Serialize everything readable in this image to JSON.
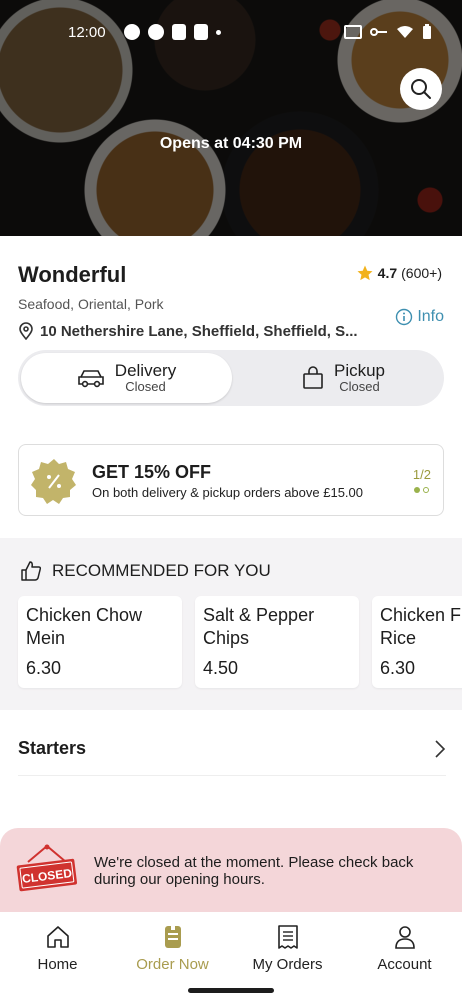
{
  "status_bar": {
    "time": "12:00"
  },
  "hero": {
    "opening_text": "Opens at 04:30 PM",
    "search_icon": "search-icon"
  },
  "restaurant": {
    "name": "Wonderful",
    "rating": "4.7",
    "rating_count": "(600+)",
    "cuisine": "Seafood, Oriental, Pork",
    "address": "10 Nethershire Lane, Sheffield, Sheffield, S...",
    "info_label": "Info"
  },
  "order_mode": {
    "options": [
      {
        "title": "Delivery",
        "status": "Closed",
        "icon": "car-icon",
        "selected": true
      },
      {
        "title": "Pickup",
        "status": "Closed",
        "icon": "bag-icon",
        "selected": false
      }
    ]
  },
  "promo": {
    "title": "GET 15% OFF",
    "subtitle": "On both delivery & pickup orders above £15.00",
    "page": "1/2",
    "badge_icon": "percent-badge-icon"
  },
  "recommended": {
    "heading": "RECOMMENDED FOR YOU",
    "items": [
      {
        "name": "Chicken Chow Mein",
        "price": "6.30"
      },
      {
        "name": "Salt & Pepper Chips",
        "price": "4.50"
      },
      {
        "name": "Chicken Fried Rice",
        "price": "6.30"
      }
    ]
  },
  "menu": {
    "categories": [
      {
        "label": "Starters"
      }
    ]
  },
  "closed_banner": {
    "sign_text": "CLOSED",
    "message": "We're closed at the moment. Please check back during our opening hours."
  },
  "bottom_nav": {
    "items": [
      {
        "label": "Home",
        "icon": "home-icon",
        "active": false
      },
      {
        "label": "Order Now",
        "icon": "menu-icon",
        "active": true
      },
      {
        "label": "My Orders",
        "icon": "receipt-icon",
        "active": false
      },
      {
        "label": "Account",
        "icon": "user-icon",
        "active": false
      }
    ]
  },
  "colors": {
    "accent": "#a99c4f",
    "link": "#3e8fb0",
    "star": "#f2b21b",
    "closed_bg": "#f4d6d9",
    "closed_sign": "#d0322f"
  }
}
